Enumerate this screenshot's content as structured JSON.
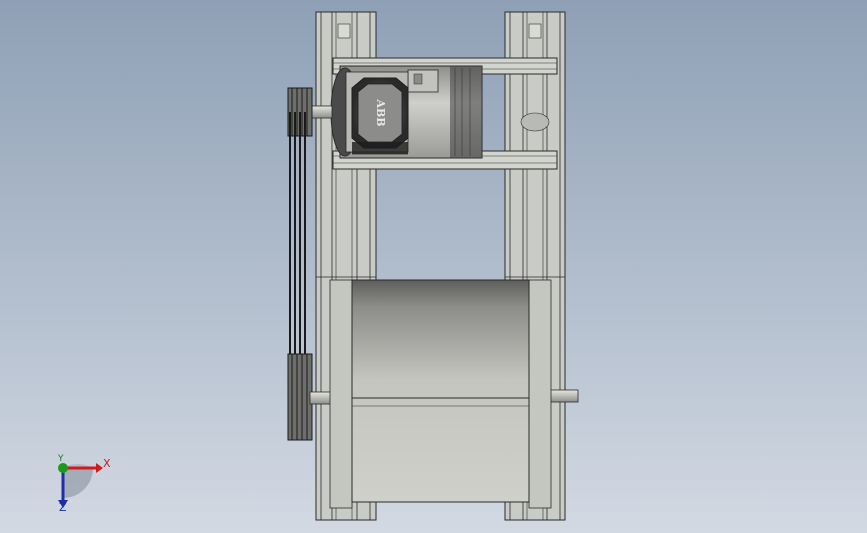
{
  "model": {
    "motor_brand": "ABB"
  },
  "triad": {
    "x_label": "X",
    "y_label": "Y",
    "z_label": "Z",
    "colors": {
      "x": "#d11a1a",
      "y": "#1b9a1b",
      "z": "#1b2fa8"
    }
  },
  "colors": {
    "background_top": "#8fa0b6",
    "background_bottom": "#d3d9e3",
    "frame": "#c9ccc6",
    "outline": "#2a2a2a",
    "motor_dark": "#4a4a4a",
    "drum": "#c6c7c1"
  }
}
